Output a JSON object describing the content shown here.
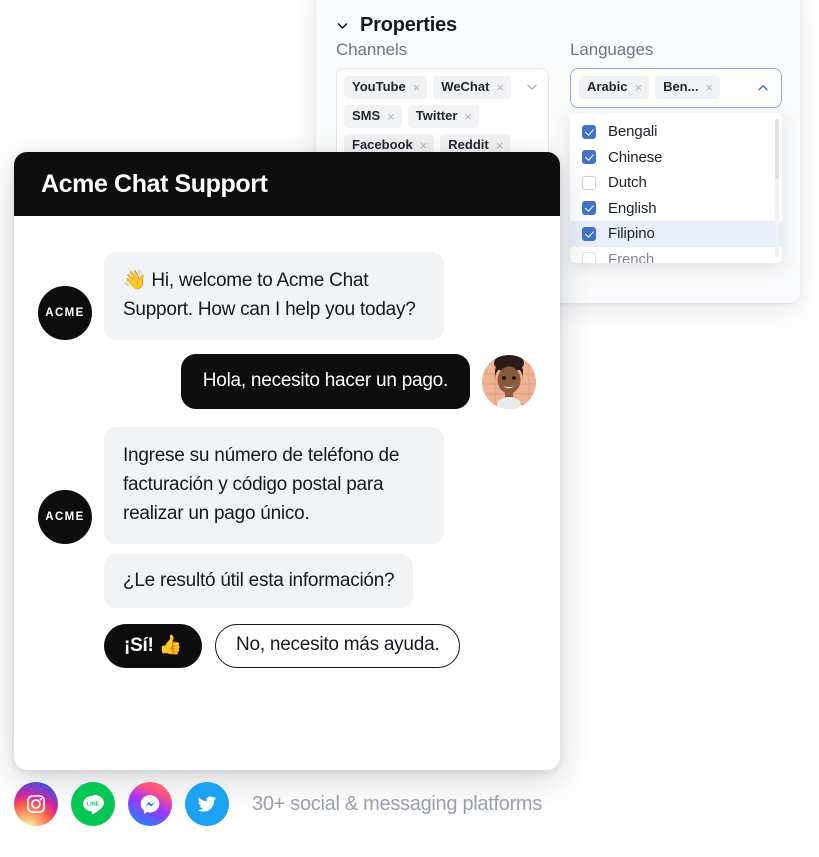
{
  "properties_panel": {
    "title": "Properties",
    "collapse_icon": "chevron-down-icon",
    "channels": {
      "label": "Channels",
      "caret_icon": "chevron-down-icon",
      "chips": [
        {
          "label": "YouTube",
          "remove": "×"
        },
        {
          "label": "WeChat",
          "remove": "×"
        },
        {
          "label": "SMS",
          "remove": "×"
        },
        {
          "label": "Twitter",
          "remove": "×"
        },
        {
          "label": "Facebook",
          "remove": "×"
        },
        {
          "label": "Reddit",
          "remove": "×"
        }
      ]
    },
    "languages": {
      "label": "Languages",
      "caret_icon": "chevron-up-icon",
      "focus_color": "#8aa9e8",
      "chips": [
        {
          "label": "Arabic",
          "remove": "×"
        },
        {
          "label": "Ben...",
          "remove": "×"
        }
      ],
      "dropdown": {
        "checkbox_color": "#4472c8",
        "highlight_color": "#e8effb",
        "options": [
          {
            "label": "Bengali",
            "checked": true,
            "highlighted": false
          },
          {
            "label": "Chinese",
            "checked": true,
            "highlighted": false
          },
          {
            "label": "Dutch",
            "checked": false,
            "highlighted": false
          },
          {
            "label": "English",
            "checked": true,
            "highlighted": false
          },
          {
            "label": "Filipino",
            "checked": true,
            "highlighted": true
          },
          {
            "label": "French",
            "checked": false,
            "highlighted": false
          }
        ]
      }
    }
  },
  "chat": {
    "title": "Acme Chat Support",
    "header_color": "#0d0d0d",
    "bot_avatar_label": "ACME",
    "messages": [
      {
        "from": "bot",
        "text": "👋 Hi, welcome to Acme Chat Support. How can I help you today?",
        "avatar": "ACME"
      },
      {
        "from": "user",
        "text": "Hola, necesito hacer un pago.",
        "avatar": "user-photo"
      },
      {
        "from": "bot",
        "text": "Ingrese su número de teléfono de facturación y código postal para realizar un pago único.",
        "avatar": "ACME"
      },
      {
        "from": "bot",
        "text": "¿Le resultó útil esta información?",
        "avatar": ""
      }
    ],
    "quick_replies": [
      {
        "label": "¡Sí! 👍",
        "style": "primary"
      },
      {
        "label": "No, necesito más ayuda.",
        "style": "secondary"
      }
    ]
  },
  "footer": {
    "caption": "30+ social & messaging platforms",
    "icons": [
      {
        "name": "instagram-icon",
        "color": "#d6249f"
      },
      {
        "name": "line-icon",
        "color": "#06c755"
      },
      {
        "name": "messenger-icon",
        "color": "#0099ff"
      },
      {
        "name": "twitter-icon",
        "color": "#1da1f2"
      }
    ]
  }
}
